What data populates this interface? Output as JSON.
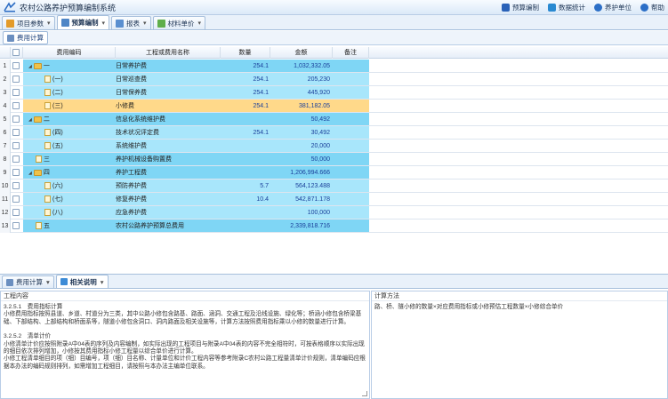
{
  "app": {
    "title": "农村公路养护预算编制系统"
  },
  "toolbar": {
    "buttons": [
      {
        "label": "预算编制",
        "color": "#2a62b8"
      },
      {
        "label": "数据统计",
        "color": "#2a8ad1"
      },
      {
        "label": "养护单位",
        "color": "#2c6fc7"
      },
      {
        "label": "帮助",
        "color": "#2c6fc7"
      }
    ]
  },
  "tabs": [
    {
      "label": "项目参数",
      "active": false,
      "icon": "gear-icon"
    },
    {
      "label": "预算编制",
      "active": true,
      "icon": "grid-icon"
    },
    {
      "label": "报表",
      "active": false,
      "icon": "chart-icon"
    },
    {
      "label": "材料单价",
      "active": false,
      "icon": "price-icon"
    }
  ],
  "panel": {
    "button": "费用计算"
  },
  "grid": {
    "columns": [
      "费用编码",
      "工程或费用名称",
      "数量",
      "金额",
      "备注"
    ],
    "rows": [
      {
        "num": "1",
        "code": "一",
        "name": "日常养护费",
        "qty": "254.1",
        "amount": "1,032,332.05",
        "level": 0,
        "type": "folder"
      },
      {
        "num": "2",
        "code": "(一)",
        "name": "日常巡查费",
        "qty": "254.1",
        "amount": "205,230",
        "level": 1,
        "type": "doc"
      },
      {
        "num": "3",
        "code": "(二)",
        "name": "日常保养费",
        "qty": "254.1",
        "amount": "445,920",
        "level": 1,
        "type": "doc"
      },
      {
        "num": "4",
        "code": "(三)",
        "name": "小修费",
        "qty": "254.1",
        "amount": "381,182.05",
        "level": 1,
        "type": "doc"
      },
      {
        "num": "5",
        "code": "二",
        "name": "信息化系统维护费",
        "qty": "",
        "amount": "50,492",
        "level": 0,
        "type": "folder"
      },
      {
        "num": "6",
        "code": "(四)",
        "name": "技术状况评定费",
        "qty": "254.1",
        "amount": "30,492",
        "level": 1,
        "type": "doc"
      },
      {
        "num": "7",
        "code": "(五)",
        "name": "系统维护费",
        "qty": "",
        "amount": "20,000",
        "level": 1,
        "type": "doc"
      },
      {
        "num": "8",
        "code": "三",
        "name": "养护机械设备购置费",
        "qty": "",
        "amount": "50,000",
        "level": 0,
        "type": "doc"
      },
      {
        "num": "9",
        "code": "四",
        "name": "养护工程费",
        "qty": "",
        "amount": "1,206,994.666",
        "level": 0,
        "type": "folder"
      },
      {
        "num": "10",
        "code": "(六)",
        "name": "预防养护费",
        "qty": "5.7",
        "amount": "564,123.488",
        "level": 1,
        "type": "doc"
      },
      {
        "num": "11",
        "code": "(七)",
        "name": "修复养护费",
        "qty": "10.4",
        "amount": "542,871.178",
        "level": 1,
        "type": "doc"
      },
      {
        "num": "12",
        "code": "(八)",
        "name": "应急养护费",
        "qty": "",
        "amount": "100,000",
        "level": 1,
        "type": "doc"
      },
      {
        "num": "13",
        "code": "五",
        "name": "农村公路养护预算总费用",
        "qty": "",
        "amount": "2,339,818.716",
        "level": 0,
        "type": "doc"
      }
    ],
    "colors": {
      "light": "#a8e6fb",
      "strong": "#7fd6f5",
      "selected": "#ffd98a"
    }
  },
  "bottom": {
    "tabs": [
      {
        "label": "费用计算",
        "active": false,
        "icon": "calc-icon"
      },
      {
        "label": "相关说明",
        "active": true,
        "icon": "info-icon"
      }
    ],
    "left_title": "工程内容",
    "right_title": "计算方法",
    "left_paragraphs": [
      "3.2.5.1　费用指标计算",
      "小修费用指标按照县道、乡道、村道分为三类，其中公路小修包含路基、路面、涵洞、交通工程及沿线设施、绿化等；桥涵小修包含桥梁基础、下部结构、上部结构和桥面系等，隧道小修包含洞口、洞内路面及相关设施等，计算方法按照费用指标乘以小修的数量进行计算。",
      "",
      "3.2.5.2　清单计价",
      "小修清单计价应按照附录A中04表的序列及内容编制，如实际出现的工程项目与附录A中04表的内容不完全相符时，可按表格顺序以实际出现的细目依次排列增加，小修按其费用指标小修工程量以综合单价进行计算。",
      "小修工程清单细目的项（细）目编号，项（细）目名称、计量单位和计价工程内容等参考附录C农村公路工程量清单计价规则，清单编码应根据本办法的编码规则排列，如需增加工程细目，请按照与本办法主编单位联系。"
    ],
    "right_text": "路、桥、隧小修的数量×对应费用指标或小修预估工程数量×小修综合单价"
  }
}
